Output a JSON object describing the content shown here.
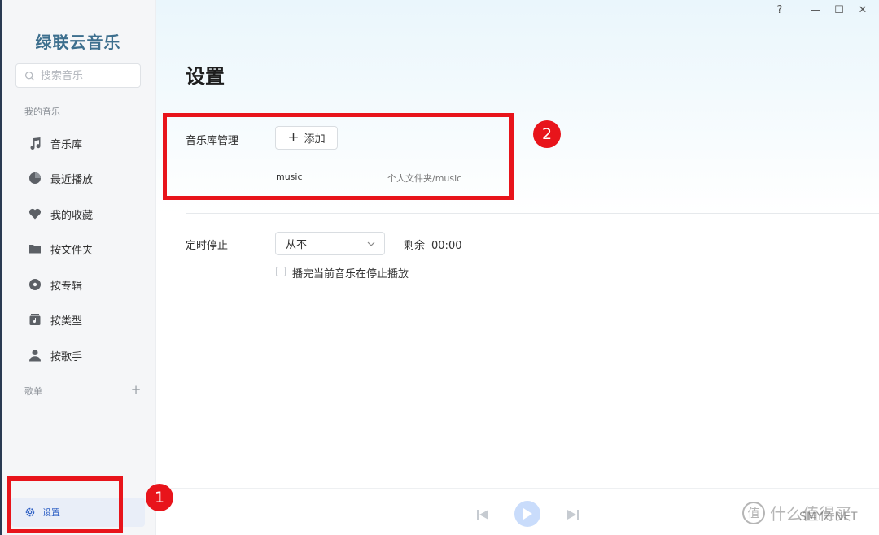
{
  "app": {
    "logo": "绿联云音乐"
  },
  "window_controls": {
    "help": "?",
    "minimize": "—",
    "maximize": "☐",
    "close": "✕"
  },
  "sidebar": {
    "search_placeholder": "搜索音乐",
    "section_my_music": "我的音乐",
    "items": [
      {
        "label": "音乐库",
        "icon": "music-note-icon"
      },
      {
        "label": "最近播放",
        "icon": "clock-icon"
      },
      {
        "label": "我的收藏",
        "icon": "heart-icon"
      },
      {
        "label": "按文件夹",
        "icon": "folder-icon"
      },
      {
        "label": "按专辑",
        "icon": "disc-icon"
      },
      {
        "label": "按类型",
        "icon": "genre-icon"
      },
      {
        "label": "按歌手",
        "icon": "singer-icon"
      }
    ],
    "section_playlists": "歌单",
    "playlist_add": "+",
    "settings_label": "设置"
  },
  "main": {
    "title": "设置",
    "library": {
      "label": "音乐库管理",
      "add_button": "添加",
      "entries": [
        {
          "name": "music",
          "path": "个人文件夹/music"
        }
      ]
    },
    "timer": {
      "label": "定时停止",
      "selected": "从不",
      "remain_label": "剩余",
      "remain_value": "00:00",
      "checkbox_label": "播完当前音乐在停止播放"
    }
  },
  "annotations": {
    "one": "1",
    "two": "2"
  },
  "watermark": {
    "logo": "值",
    "text": "什么值得买",
    "site": "SMYZ.NET"
  },
  "colors": {
    "accent": "#2d5fc4",
    "annotation": "#e8141b",
    "logo": "#3d6f8e"
  }
}
